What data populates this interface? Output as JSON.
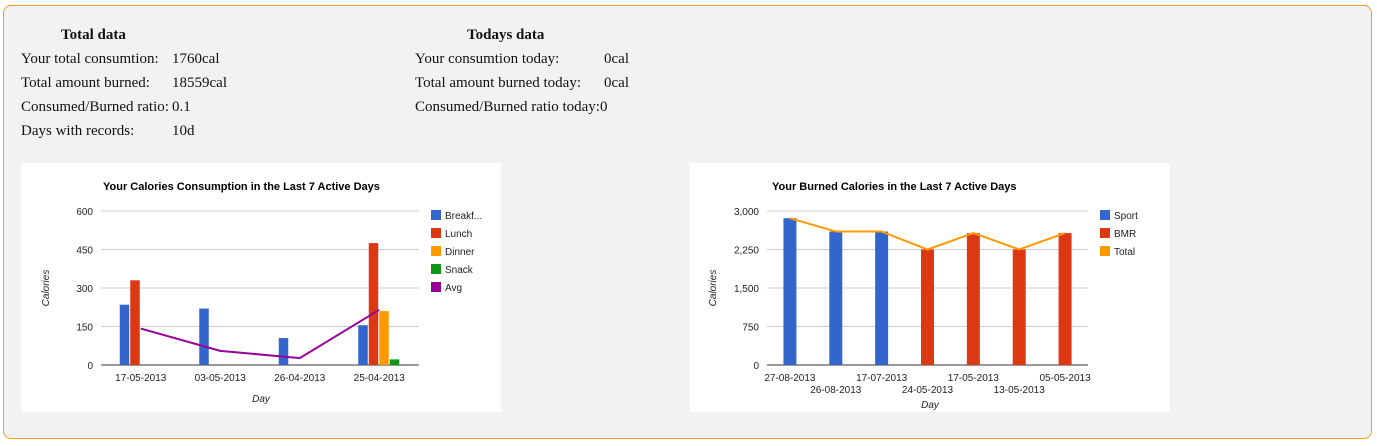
{
  "total": {
    "title": "Total data",
    "rows": [
      {
        "label": "Your total consumtion:",
        "value": "1760cal"
      },
      {
        "label": "Total amount burned:",
        "value": "18559cal"
      },
      {
        "label": "Consumed/Burned ratio:",
        "value": "0.1"
      },
      {
        "label": "Days with records:",
        "value": "10d"
      }
    ]
  },
  "today": {
    "title": "Todays data",
    "rows": [
      {
        "label": "Your consumtion today:",
        "value": "0cal"
      },
      {
        "label": "Total amount burned today:",
        "value": "0cal"
      },
      {
        "label": "Consumed/Burned ratio today:",
        "value": "0"
      }
    ]
  },
  "chart_data": [
    {
      "type": "bar",
      "title": "Your Calories Consumption in the Last 7 Active Days",
      "xlabel": "Day",
      "ylabel": "Calories",
      "ylim": [
        0,
        600
      ],
      "yticks": [
        0,
        150,
        300,
        450,
        600
      ],
      "grid": true,
      "legend_position": "right",
      "categories": [
        "17-05-2013",
        "03-05-2013",
        "26-04-2013",
        "25-04-2013"
      ],
      "series": [
        {
          "name": "Breakf...",
          "color": "#3366cc",
          "values": [
            235,
            220,
            105,
            155
          ]
        },
        {
          "name": "Lunch",
          "color": "#dc3912",
          "values": [
            330,
            0,
            0,
            475
          ]
        },
        {
          "name": "Dinner",
          "color": "#ff9900",
          "values": [
            0,
            0,
            0,
            210
          ]
        },
        {
          "name": "Snack",
          "color": "#109618",
          "values": [
            0,
            0,
            0,
            22
          ]
        }
      ],
      "lines": [
        {
          "name": "Avg",
          "color": "#990099",
          "values": [
            142,
            55,
            27,
            215
          ]
        }
      ]
    },
    {
      "type": "bar",
      "title": "Your Burned Calories in the Last 7 Active Days",
      "xlabel": "Day",
      "ylabel": "Calories",
      "ylim": [
        0,
        3000
      ],
      "yticks": [
        0,
        750,
        1500,
        2250,
        3000
      ],
      "ytick_labels": [
        "0",
        "750",
        "1,500",
        "2,250",
        "3,000"
      ],
      "grid": true,
      "legend_position": "right",
      "categories": [
        "27-08-2013",
        "26-08-2013",
        "17-07-2013",
        "24-05-2013",
        "17-05-2013",
        "13-05-2013",
        "05-05-2013"
      ],
      "series": [
        {
          "name": "Sport",
          "color": "#3366cc",
          "values": [
            2860,
            2600,
            2600,
            0,
            0,
            0,
            0
          ]
        },
        {
          "name": "BMR",
          "color": "#dc3912",
          "values": [
            0,
            0,
            0,
            2250,
            2570,
            2250,
            2570
          ]
        }
      ],
      "lines": [
        {
          "name": "Total",
          "color": "#ff9900",
          "values": [
            2860,
            2600,
            2600,
            2250,
            2570,
            2250,
            2570
          ]
        }
      ]
    }
  ]
}
